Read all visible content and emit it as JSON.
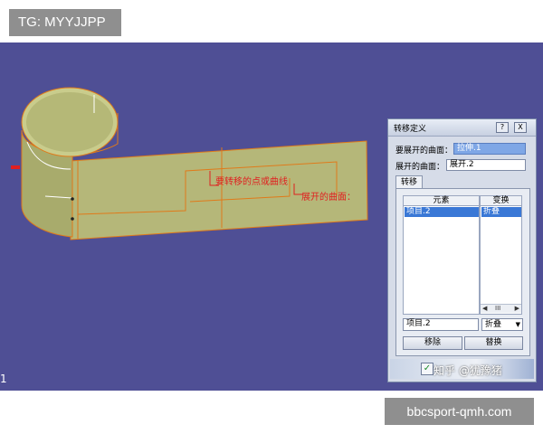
{
  "overlays": {
    "top_left_badge": "TG: MYYJJPP",
    "bottom_right_badge": "bbcsport-qmh.com",
    "corner_number": "1"
  },
  "model_labels": {
    "translate_curve": "要转移的点或曲线",
    "unfolded_surface": "展开的曲面："
  },
  "dialog": {
    "title": "转移定义",
    "help_label": "?",
    "close_label": "X",
    "surface_to_unfold_label": "要展开的曲面：",
    "surface_to_unfold_value": "拉伸.1",
    "unfolded_surface_label": "展开的曲面：",
    "unfolded_surface_value": "展开.2",
    "tab_label": "转移",
    "columns": {
      "element": "元素",
      "transform": "变换"
    },
    "rows": [
      {
        "element": "项目.2",
        "transform": "折叠"
      }
    ],
    "scroll_indicator": "III",
    "edit_element_value": "项目.2",
    "edit_transform_value": "折叠",
    "remove_button": "移除",
    "replace_button": "替换",
    "ok_symbol": "✓"
  },
  "watermark": "知乎 @犹豫猪",
  "colors": {
    "viewport_bg": "#4f4f95",
    "surface_fill": "#b5b779",
    "edge_orange": "#e07a1a",
    "annotation_red": "#e02020",
    "selection_blue": "#3a78d6"
  }
}
